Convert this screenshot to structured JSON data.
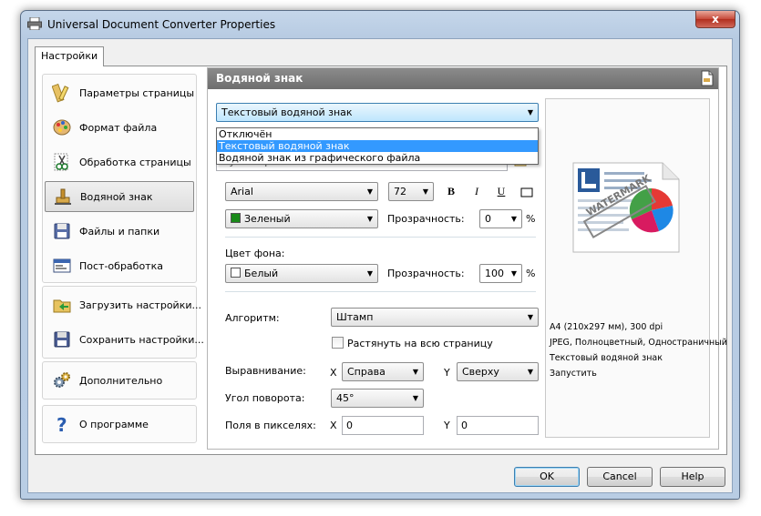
{
  "window": {
    "title": "Universal Document Converter Properties",
    "close_glyph": "x"
  },
  "tab": {
    "label": "Настройки"
  },
  "sidebar": {
    "groups": [
      {
        "items": [
          {
            "label": "Параметры страницы",
            "icon": "ruler-pencil-icon"
          },
          {
            "label": "Формат файла",
            "icon": "palette-icon"
          },
          {
            "label": "Обработка страницы",
            "icon": "scissors-icon"
          },
          {
            "label": "Водяной знак",
            "icon": "watermark-icon",
            "selected": true
          },
          {
            "label": "Файлы и папки",
            "icon": "floppy-icon"
          },
          {
            "label": "Пост-обработка",
            "icon": "window-icon"
          }
        ]
      },
      {
        "items": [
          {
            "label": "Загрузить настройки...",
            "icon": "load-settings-icon"
          },
          {
            "label": "Сохранить настройки...",
            "icon": "save-settings-icon"
          }
        ]
      },
      {
        "items": [
          {
            "label": "Дополнительно",
            "icon": "gears-icon"
          }
        ]
      },
      {
        "items": [
          {
            "label": "О программе",
            "icon": "question-icon"
          }
        ]
      }
    ]
  },
  "panel": {
    "title": "Водяной знак",
    "watermark_type": {
      "selected": "Текстовый водяной знак",
      "options": [
        "Отключён",
        "Текстовый водяной знак",
        "Водяной знак из графического файла"
      ],
      "highlighted_index": 1
    },
    "text_value": "My Stamp",
    "font": {
      "name": "Arial",
      "size": "72",
      "bold": "B",
      "italic": "I",
      "underline": "U"
    },
    "text_color": {
      "label": "Зеленый",
      "swatch": "#1a8a1a"
    },
    "text_transparency": {
      "label": "Прозрачность:",
      "value": "0",
      "unit": "%"
    },
    "background": {
      "section_label": "Цвет фона:",
      "color": {
        "label": "Белый",
        "swatch": "#ffffff"
      },
      "transparency": {
        "label": "Прозрачность:",
        "value": "100",
        "unit": "%"
      }
    },
    "algorithm": {
      "label": "Алгоритм:",
      "value": "Штамп"
    },
    "stretch": {
      "label": "Растянуть на всю страницу",
      "checked": false
    },
    "alignment": {
      "label": "Выравнивание:",
      "x_label": "X",
      "x_value": "Справа",
      "y_label": "Y",
      "y_value": "Сверху"
    },
    "rotation": {
      "label": "Угол поворота:",
      "value": "45°"
    },
    "margins": {
      "label": "Поля в пикселях:",
      "x_label": "X",
      "x_value": "0",
      "y_label": "Y",
      "y_value": "0"
    },
    "preview": {
      "watermark_text": "WATERMARK",
      "info": [
        "A4 (210x297 мм), 300 dpi",
        "JPEG, Полноцветный, Одностраничный",
        "Текстовый водяной знак",
        "Запустить"
      ]
    }
  },
  "buttons": {
    "ok": "OK",
    "cancel": "Cancel",
    "help": "Help"
  }
}
